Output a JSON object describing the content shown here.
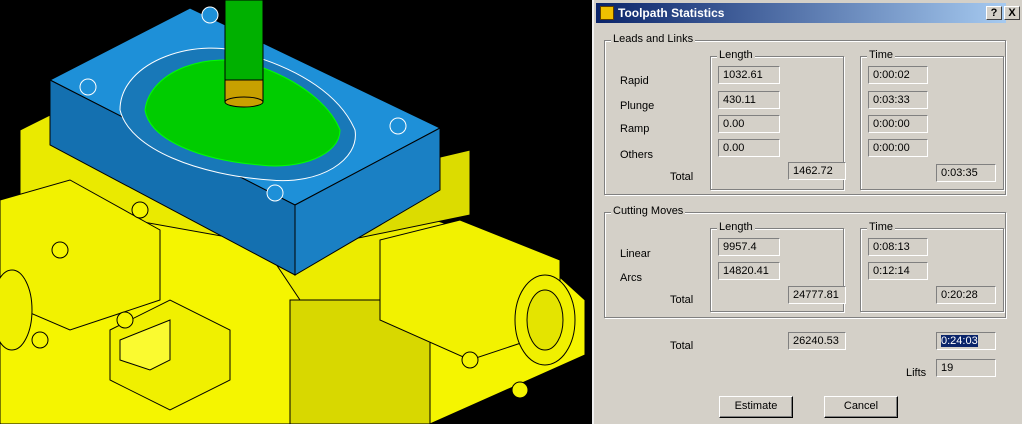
{
  "dialog": {
    "title": "Toolpath Statistics",
    "help_label": "?",
    "close_label": "X",
    "leads": {
      "group_label": "Leads and Links",
      "length_header": "Length",
      "time_header": "Time",
      "rows": [
        {
          "label": "Rapid",
          "length": "1032.61",
          "time": "0:00:02"
        },
        {
          "label": "Plunge",
          "length": "430.11",
          "time": "0:03:33"
        },
        {
          "label": "Ramp",
          "length": "0.00",
          "time": "0:00:00"
        },
        {
          "label": "Others",
          "length": "0.00",
          "time": "0:00:00"
        }
      ],
      "total_label": "Total",
      "total_length": "1462.72",
      "total_time": "0:03:35"
    },
    "cutting": {
      "group_label": "Cutting Moves",
      "length_header": "Length",
      "time_header": "Time",
      "rows": [
        {
          "label": "Linear",
          "length": "9957.4",
          "time": "0:08:13"
        },
        {
          "label": "Arcs",
          "length": "14820.41",
          "time": "0:12:14"
        }
      ],
      "total_label": "Total",
      "total_length": "24777.81",
      "total_time": "0:20:28"
    },
    "grand_total": {
      "label": "Total",
      "length": "26240.53",
      "time": "0:24:03"
    },
    "lifts": {
      "label": "Lifts",
      "value": "19"
    },
    "buttons": {
      "estimate": "Estimate",
      "cancel": "Cancel"
    }
  },
  "colors": {
    "title_bar_start": "#0a246a",
    "title_bar_end": "#a6caf0",
    "dialog_bg": "#d4d0c8",
    "viewport_bg": "#000000",
    "part_blue": "#1e90d8",
    "fixture_yellow": "#f5f500",
    "toolpath_green": "#00e000"
  }
}
